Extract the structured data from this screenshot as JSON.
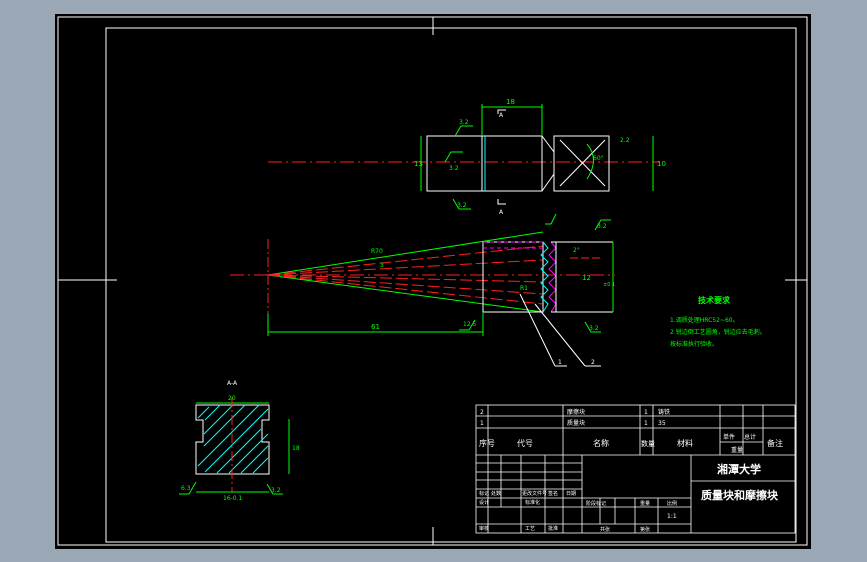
{
  "views": {
    "top_dims": {
      "width_top": "18",
      "left_height": "13",
      "right_height": "10",
      "right_small": "2.2",
      "rough_a": "3.2",
      "rough_b": "3.2",
      "rough_c": "3.2",
      "section_mark": "A",
      "angle": "60°"
    },
    "middle_dims": {
      "radius": "R70",
      "angle_value": "3",
      "half_angle": "2°",
      "length": "61",
      "rough_right": "3.2",
      "rough_left": "12.5",
      "rough_bottom": "3.2",
      "r1": "R1",
      "height": "12",
      "height_tol": "±0.1",
      "leader_1": "1",
      "leader_2": "2"
    },
    "section_view": {
      "title": "A-A",
      "width_top": "20",
      "height_right": "18",
      "bottom_dim": "16-0.1",
      "rough_left": "6.3",
      "rough_bottom": "3.2"
    }
  },
  "tech_notes": {
    "heading": "技术要求",
    "lines": [
      "1.调质处理HRC52~60。",
      "2.锐边倒工艺圆角，锐边应去毛刺。",
      "按标准执行验收。"
    ]
  },
  "parts_list": {
    "rows": [
      {
        "no": "2",
        "code": "",
        "name": "摩擦块",
        "qty": "1",
        "material": "铸铁",
        "weight": "",
        "remark": ""
      },
      {
        "no": "1",
        "code": "",
        "name": "质量块",
        "qty": "1",
        "material": "35",
        "weight": "",
        "remark": ""
      }
    ],
    "header": {
      "no": "序号",
      "code": "代号",
      "name": "名称",
      "qty": "数量",
      "material": "材料",
      "single": "单件",
      "total": "总计",
      "weight": "重量",
      "remark": "备注"
    }
  },
  "title_block": {
    "school": "湘潭大学",
    "drawing_title": "质量块和摩擦块",
    "scale": "1:1",
    "labels": {
      "mark": "标记",
      "count": "处数",
      "doc": "更改文件号",
      "sign": "签名",
      "date": "日期",
      "design": "设计",
      "std": "标准化",
      "stage_mark": "阶段标记",
      "weight": "重量",
      "ratio": "比例",
      "review": "审核",
      "process": "工艺",
      "approve": "批准",
      "total_sheets": "共张",
      "sheet_no": "第张",
      "date2": "日期"
    }
  }
}
